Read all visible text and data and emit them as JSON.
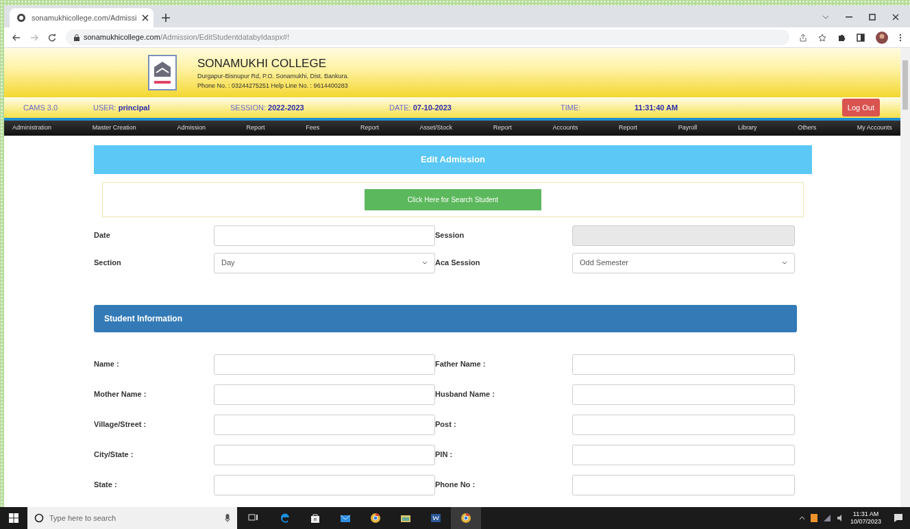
{
  "browser": {
    "tab_title": "sonamukhicollege.com/Admissi",
    "url_host": "sonamukhicollege.com",
    "url_path": "/Admission/EditStudentdatabyIdaspx#!"
  },
  "header": {
    "college_name": "SONAMUKHI COLLEGE",
    "address": "Durgapur-Bisnupur Rd, P.O. Sonamukhi, Dist. Bankura.",
    "phone": "Phone No. : 03244275251  Help Line No. : 9614400283"
  },
  "status_bar": {
    "version": "CAMS 3.0",
    "user_label": "USER:",
    "user": "principal",
    "session_label": "SESSION:",
    "session": "2022-2023",
    "date_label": "DATE:",
    "date": "07-10-2023",
    "time_label": "TIME:",
    "time": "11:31:40 AM",
    "logout": "Log Out"
  },
  "menu": [
    "Administration",
    "Master Creation",
    "Admission",
    "Report",
    "Fees",
    "Report",
    "Asset/Stock",
    "Report",
    "Accounts",
    "Report",
    "Payroll",
    "Library",
    "Others",
    "My Accounts"
  ],
  "form": {
    "title": "Edit Admission",
    "search_button": "Click Here for Search Student",
    "fields": [
      {
        "label": "Date",
        "kind": "input",
        "disabled": false
      },
      {
        "label": "Session",
        "kind": "input",
        "disabled": true
      },
      {
        "label": "Section",
        "kind": "select",
        "disabled": false,
        "value": "Day"
      },
      {
        "label": "Aca Session",
        "kind": "select",
        "disabled": false,
        "value": "Odd Semester"
      }
    ]
  },
  "student_info": {
    "title": "Student Information",
    "fields": [
      "Name :",
      "Father Name :",
      "Mother Name :",
      "Husband Name :",
      "Village/Street :",
      "Post :",
      "City/State :",
      "PIN :",
      "State :",
      "Phone No :"
    ]
  },
  "taskbar": {
    "search_placeholder": "Type here to search",
    "time": "11:31 AM",
    "date": "10/07/2023"
  }
}
